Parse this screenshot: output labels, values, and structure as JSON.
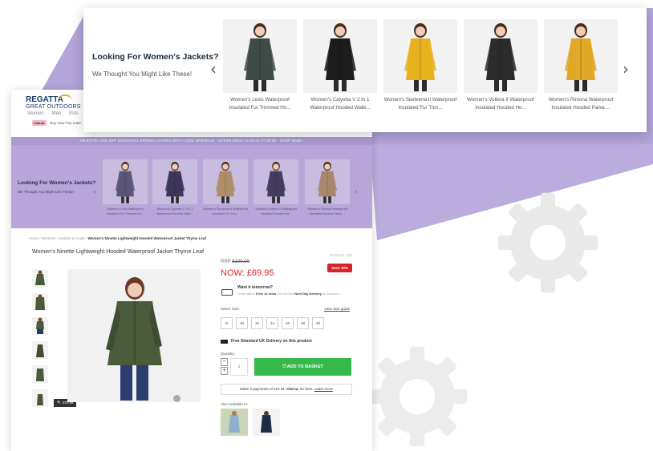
{
  "popup": {
    "title": "Looking For Women's Jackets?",
    "subtitle": "We Thought You Might Like These!",
    "products": [
      {
        "name": "Women's Lexis Waterproof Insulated Fur Trimmed Ho...",
        "color": "#3f4b47"
      },
      {
        "name": "Women's Calyetta V 3 In 1 Waterproof Hooded Walki...",
        "color": "#1c1c1c"
      },
      {
        "name": "Women's Sierleena II Waterproof Insulated Fur Trim...",
        "color": "#e8b21f"
      },
      {
        "name": "Women's Voltera II Waterproof Insulated Hooded He...",
        "color": "#2c2c2c"
      },
      {
        "name": "Women's Rimona Waterproof Insulated Hooded Parka ...",
        "color": "#e0a824"
      }
    ]
  },
  "site": {
    "brand": "REGATTA",
    "brand_sub": "GREAT OUTDOORS",
    "nav": [
      "Women",
      "Men",
      "Kids"
    ],
    "klarna_badge": "Klarna",
    "klarna_text": "Buy Now Pay Later",
    "promo": "AN EXTRA 10% OFF ESSENTIAL SPRING LAYERS WITH CODE SPRING10 · OFFER ENDS 12.04.21 AT 00:00 · SHOP NOW ›"
  },
  "inner_rec": {
    "title": "Looking For Women's Jackets?",
    "subtitle": "We Thought You Might Like These!",
    "products": [
      {
        "name": "Women's Lexis Waterproof Insulated Fur Trimmed Ho...",
        "color": "#5c5678"
      },
      {
        "name": "Women's Calyetta V 3 In 1 Waterproof Hooded Walki...",
        "color": "#3d3658"
      },
      {
        "name": "Women's Sierleena II Waterproof Insulated Fur Trim...",
        "color": "#b08e6a"
      },
      {
        "name": "Women's Voltera II Waterproof Insulated Hooded He...",
        "color": "#433c5e"
      },
      {
        "name": "Women's Rimona Waterproof Insulated Hooded Parka ...",
        "color": "#a8876e"
      }
    ]
  },
  "product": {
    "breadcrumb": [
      "Home",
      "Womens",
      "Jackets & Coats",
      "Women's Ninette Lightweight Hooded Waterproof Jacket Thyme Leaf"
    ],
    "title": "Women's Ninette Lightweight Hooded Waterproof Jacket Thyme Leaf",
    "ref": "RWW334 70R",
    "rrp_label": "RRP",
    "rrp": "£100.00",
    "now": "NOW: £69.95",
    "save": "Save 30%",
    "delivery_heading": "Want it tomorrow?",
    "delivery_pre": "Order within",
    "delivery_time": "8 hrs 41 mins",
    "delivery_mid": "and choose",
    "delivery_option": "Next Day Delivery",
    "delivery_post": "at checkout.",
    "size_label": "Select Size:",
    "size_guide": "View Size guide",
    "sizes": [
      "8",
      "10",
      "12",
      "14",
      "16",
      "18",
      "20"
    ],
    "free_delivery": "Free Standard UK Delivery on this product",
    "quantity_label": "Quantity:",
    "quantity": "1",
    "basket": "ADD TO BASKET",
    "klarna_pre": "Make 3 payments of £23.31.",
    "klarna_brand": "Klarna.",
    "klarna_mid": "No fees.",
    "klarna_link": "Learn more",
    "also_available": "Also Available In:",
    "zoom": "ZOOM",
    "jacket_color": "#4a5a3a"
  }
}
